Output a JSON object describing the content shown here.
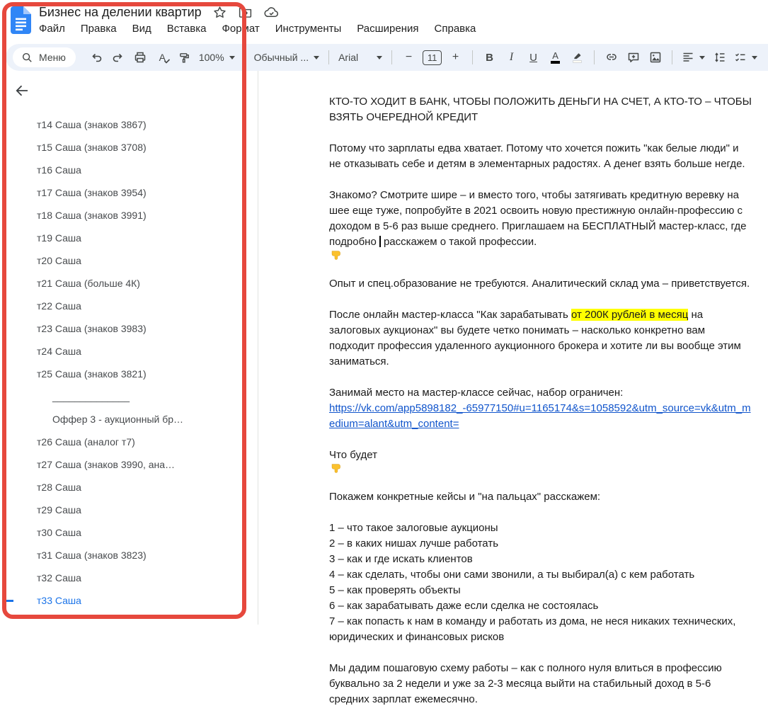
{
  "window": {
    "title": "Бизнес на делении квартир"
  },
  "menubar": {
    "items": [
      "Файл",
      "Правка",
      "Вид",
      "Вставка",
      "Формат",
      "Инструменты",
      "Расширения",
      "Справка"
    ]
  },
  "toolbar": {
    "search_label": "Меню",
    "zoom_value": "100%",
    "style_value": "Обычный ...",
    "font_value": "Arial",
    "font_size": "11",
    "minus_label": "−",
    "plus_label": "+",
    "bold_label": "B",
    "italic_label": "I",
    "underline_label": "U",
    "text_color_label": "A",
    "spellcheck_label": "A"
  },
  "outline": {
    "items": [
      {
        "label": "т14 Саша (знаков 3867)",
        "style": "normal"
      },
      {
        "label": "т15 Саша (знаков 3708)",
        "style": "normal"
      },
      {
        "label": "т16 Саша",
        "style": "normal"
      },
      {
        "label": "т17 Саша (знаков 3954)",
        "style": "normal"
      },
      {
        "label": "т18 Саша (знаков 3991)",
        "style": "normal"
      },
      {
        "label": "т19 Саша",
        "style": "normal"
      },
      {
        "label": "т20 Саша",
        "style": "normal"
      },
      {
        "label": "т21 Саша (больше 4К)",
        "style": "normal"
      },
      {
        "label": "т22 Саша",
        "style": "normal"
      },
      {
        "label": "т23 Саша (знаков 3983)",
        "style": "normal"
      },
      {
        "label": "т24 Саша",
        "style": "normal"
      },
      {
        "label": "т25 Саша (знаков 3821)",
        "style": "normal"
      },
      {
        "label": "______________",
        "style": "indent"
      },
      {
        "label": "Оффер 3 - аукционный бр…",
        "style": "indent"
      },
      {
        "label": "т26 Саша (аналог т7)",
        "style": "normal"
      },
      {
        "label": "т27 Саша (знаков 3990, ана…",
        "style": "normal"
      },
      {
        "label": "т28 Саша",
        "style": "normal"
      },
      {
        "label": "т29 Саша",
        "style": "normal"
      },
      {
        "label": "т30 Саша",
        "style": "normal"
      },
      {
        "label": "т31 Саша (знаков 3823)",
        "style": "normal"
      },
      {
        "label": "т32 Саша",
        "style": "normal"
      },
      {
        "label": "т33 Саша",
        "style": "active"
      }
    ]
  },
  "document": {
    "heading": "КТО-ТО ХОДИТ В БАНК, ЧТОБЫ ПОЛОЖИТЬ ДЕНЬГИ НА СЧЕТ, А КТО-ТО – ЧТОБЫ ВЗЯТЬ ОЧЕРЕДНОЙ КРЕДИТ",
    "para_why": "Потому что зарплаты едва хватает. Потому что хочется пожить \"как белые люди\" и не отказывать себе и детям в элементарных радостях. А денег взять больше негде.",
    "para_offer_part1": "Знакомо? Смотрите шире – и вместо того, чтобы затягивать кредитную веревку на шее еще туже, попробуйте в 2021 освоить новую престижную онлайн-профессию с доходом в 5-6 раз выше среднего. Приглашаем на БЕСПЛАТНЫЙ мастер-класс, где подробно",
    "para_offer_part2": " расскажем о такой профессии.",
    "para_experience": "Опыт и спец.образование не требуются. Аналитический склад ума – приветствуется.",
    "para_after_part1": "После онлайн мастер-класса \"Как зарабатывать ",
    "para_after_highlight": "от 200К рублей в месяц",
    "para_after_part2": " на залоговых аукционах\" вы будете четко понимать – насколько конкретно вам подходит профессия удаленного аукционного брокера и хотите ли вы вообще этим заниматься.",
    "para_signup": "Занимай место на мастер-классе сейчас, набор ограничен:",
    "signup_link": "https://vk.com/app5898182_-65977150#u=1165174&s=1058592&utm_source=vk&utm_medium=alant&utm_content=",
    "para_whatwill": "Что будет",
    "para_cases": "Покажем конкретные кейсы и \"на пальцах\" расскажем:",
    "list_items": [
      "1 – что такое залоговые аукционы",
      "2 – в каких нишах лучше работать",
      "3 – как и где искать клиентов",
      "4 – как сделать, чтобы они сами звонили, а ты выбирал(а) с кем работать",
      "5 – как проверять объекты",
      "6 – как зарабатывать даже если сделка не состоялась",
      "7 – как попасть к нам в команду и работать из дома, не неся никаких технических, юридических и финансовых рисков"
    ],
    "para_scheme": "Мы дадим пошаговую схему работы – как с полного нуля влиться в профессию буквально за 2 недели и уже за 2-3 месяца выйти на стабильный доход в 5-6 средних зарплат ежемесячно."
  },
  "colors": {
    "annotation_red": "#e6483d",
    "highlight_yellow": "#ffff00",
    "link_blue": "#1155cc",
    "active_item_blue": "#1a73e8",
    "toolbar_bg": "#edf2fa",
    "docs_icon_blue": "#3086f6"
  }
}
